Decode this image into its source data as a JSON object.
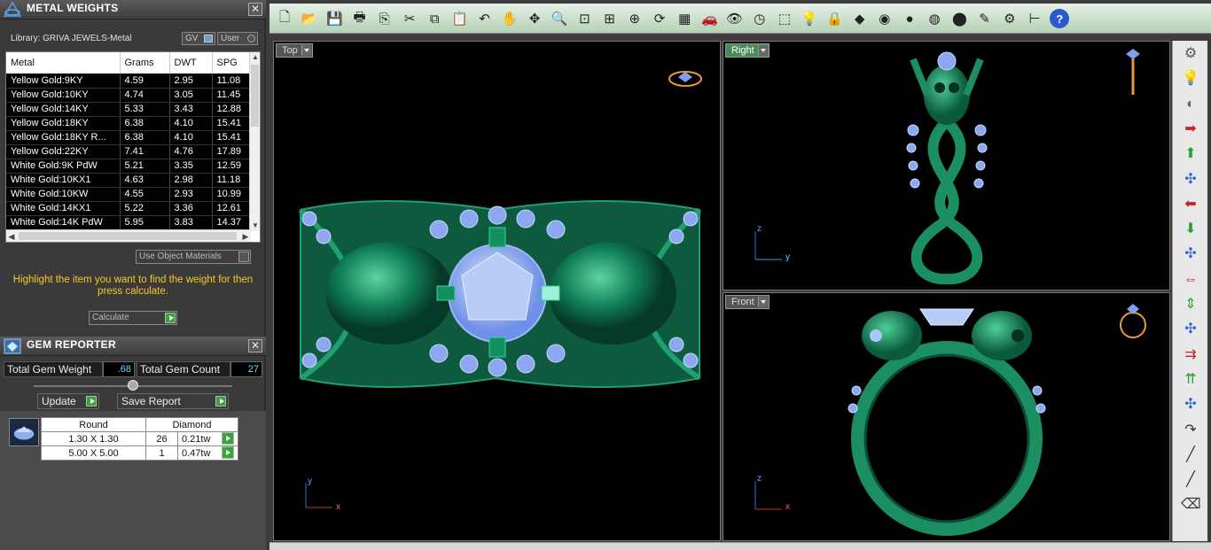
{
  "metal_panel": {
    "title": "METAL WEIGHTS",
    "library": "Library: GRIVA JEWELS-Metal",
    "gv_label": "GV",
    "user_label": "User",
    "columns": [
      "Metal",
      "Grams",
      "DWT",
      "SPG"
    ],
    "rows": [
      [
        "Yellow Gold:9KY",
        "4.59",
        "2.95",
        "11.08"
      ],
      [
        "Yellow Gold:10KY",
        "4.74",
        "3.05",
        "11.45"
      ],
      [
        "Yellow Gold:14KY",
        "5.33",
        "3.43",
        "12.88"
      ],
      [
        "Yellow Gold:18KY",
        "6.38",
        "4.10",
        "15.41"
      ],
      [
        "Yellow Gold:18KY R...",
        "6.38",
        "4.10",
        "15.41"
      ],
      [
        "Yellow Gold:22KY",
        "7.41",
        "4.76",
        "17.89"
      ],
      [
        "White Gold:9K PdW",
        "5.21",
        "3.35",
        "12.59"
      ],
      [
        "White Gold:10KX1",
        "4.63",
        "2.98",
        "11.18"
      ],
      [
        "White Gold:10KW",
        "4.55",
        "2.93",
        "10.99"
      ],
      [
        "White Gold:14KX1",
        "5.22",
        "3.36",
        "12.61"
      ],
      [
        "White Gold:14K PdW",
        "5.95",
        "3.83",
        "14.37"
      ]
    ],
    "use_object_materials": "Use Object Materials",
    "hint": "Highlight the item you want to find the weight for then press calculate.",
    "calculate": "Calculate"
  },
  "gem_panel": {
    "title": "GEM REPORTER",
    "total_weight_label": "Total Gem Weight",
    "total_weight_value": ".68",
    "total_count_label": "Total Gem Count",
    "total_count_value": "27",
    "update": "Update",
    "save_report": "Save Report",
    "table_headers": [
      "Round",
      "Diamond"
    ],
    "rows": [
      [
        "1.30 X 1.30",
        "26",
        "0.21tw"
      ],
      [
        "5.00 X 5.00",
        "1",
        "0.47tw"
      ]
    ]
  },
  "viewports": {
    "top": {
      "label": "Top",
      "axis1": "y",
      "axis2": "x"
    },
    "right": {
      "label": "Right",
      "axis1": "z",
      "axis2": "y"
    },
    "front": {
      "label": "Front",
      "axis1": "z",
      "axis2": "x"
    }
  },
  "toolbar_icons": [
    "new-icon",
    "open-icon",
    "save-icon",
    "print-icon",
    "export-icon",
    "cut-icon",
    "copy-icon",
    "paste-icon",
    "undo-icon",
    "pan-hand-icon",
    "move-icon",
    "zoom-in-icon",
    "zoom-window-icon",
    "zoom-extents-icon",
    "zoom-selected-icon",
    "rotate-view-icon",
    "four-view-icon",
    "car-icon",
    "eye-icon",
    "clock-icon",
    "snap-icon",
    "lightbulb-icon",
    "lock-icon",
    "layers-icon",
    "color-wheel-icon",
    "sphere-shaded-icon",
    "sphere-render-icon",
    "sphere-blue-icon",
    "pencil-icon",
    "gear-icon",
    "dimension-icon",
    "help-icon"
  ],
  "right_tool_icons": [
    "settings-dots-icon",
    "lightbulb-icon",
    "sphere-icon",
    "arrow-right-icon",
    "arrow-up-icon",
    "axis-move-icon",
    "arrow-left-icon",
    "arrow-down-icon",
    "axis-move-down-icon",
    "double-arrow-horizontal-icon",
    "double-arrow-vertical-icon",
    "axis-vertical-icon",
    "arrows-in-icon",
    "arrows-stack-icon",
    "axis-blue-icon",
    "curve-tool-icon",
    "line-tool-icon",
    "line-tool-2-icon",
    "eraser-icon"
  ]
}
